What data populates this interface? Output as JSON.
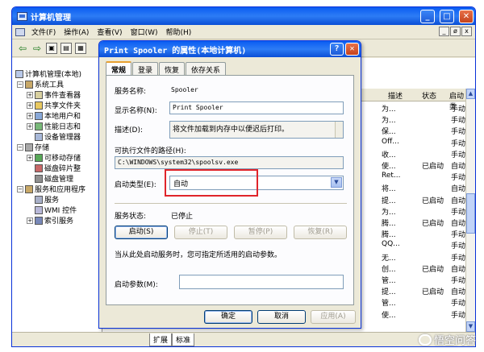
{
  "main_window": {
    "title": "计算机管理",
    "menu": [
      "文件(F)",
      "操作(A)",
      "查看(V)",
      "窗口(W)",
      "帮助(H)"
    ],
    "min_label": "_",
    "max_label": "□",
    "close_label": "✕",
    "mdi_buttons": [
      "_",
      "ø",
      "x"
    ]
  },
  "tree": {
    "root": "计算机管理(本地)",
    "items": [
      "系统工具",
      "事件查看器",
      "共享文件夹",
      "本地用户和",
      "性能日志和",
      "设备管理器",
      "存储",
      "可移动存储",
      "磁盘碎片整",
      "磁盘管理",
      "服务和应用程序",
      "服务",
      "WMI 控件",
      "索引服务"
    ]
  },
  "list": {
    "headers": [
      "描述",
      "状态",
      "启动类"
    ],
    "rows": [
      {
        "desc": "为...",
        "status": "",
        "type": "手动"
      },
      {
        "desc": "为...",
        "status": "",
        "type": "手动"
      },
      {
        "desc": "保...",
        "status": "",
        "type": "手动"
      },
      {
        "desc": "Off...",
        "status": "",
        "type": "手动"
      },
      {
        "desc": "收...",
        "status": "",
        "type": "手动"
      },
      {
        "desc": "使...",
        "status": "已启动",
        "type": "自动"
      },
      {
        "desc": "Ret...",
        "status": "",
        "type": "手动"
      },
      {
        "desc": "将...",
        "status": "",
        "type": "自动"
      },
      {
        "desc": "提...",
        "status": "已启动",
        "type": "自动"
      },
      {
        "desc": "为...",
        "status": "",
        "type": "手动"
      },
      {
        "desc": "腾...",
        "status": "已启动",
        "type": "自动"
      },
      {
        "desc": "腾...",
        "status": "",
        "type": "手动"
      },
      {
        "desc": "QQ...",
        "status": "",
        "type": "手动"
      },
      {
        "desc": "无...",
        "status": "",
        "type": "手动"
      },
      {
        "desc": "创...",
        "status": "已启动",
        "type": "自动"
      },
      {
        "desc": "管...",
        "status": "",
        "type": "手动"
      },
      {
        "desc": "提...",
        "status": "已启动",
        "type": "自动"
      },
      {
        "desc": "管...",
        "status": "",
        "type": "手动"
      },
      {
        "desc": "使...",
        "status": "",
        "type": "手动"
      }
    ]
  },
  "bottom_tabs": [
    "扩展",
    "标准"
  ],
  "dialog": {
    "title": "Print Spooler 的属性(本地计算机)",
    "help_label": "?",
    "close_label": "✕",
    "tabs": [
      "常规",
      "登录",
      "恢复",
      "依存关系"
    ],
    "service_name_label": "服务名称:",
    "service_name": "Spooler",
    "display_name_label": "显示名称(N):",
    "display_name": "Print Spooler",
    "description_label": "描述(D):",
    "description": "将文件加载到内存中以便迟后打印。",
    "exe_path_label": "可执行文件的路径(H):",
    "exe_path": "C:\\WINDOWS\\system32\\spoolsv.exe",
    "startup_type_label": "启动类型(E):",
    "startup_type": "自动",
    "status_label": "服务状态:",
    "status": "已停止",
    "btn_start": "启动(S)",
    "btn_stop": "停止(T)",
    "btn_pause": "暂停(P)",
    "btn_resume": "恢复(R)",
    "hint": "当从此处启动服务时，您可指定所适用的启动参数。",
    "params_label": "启动参数(M):",
    "params_value": "",
    "btn_ok": "确定",
    "btn_cancel": "取消",
    "btn_apply": "应用(A)"
  },
  "watermark": "悟空问答",
  "colors": {
    "highlight": "#e0242a",
    "title_bar": "#0a5cf2"
  }
}
